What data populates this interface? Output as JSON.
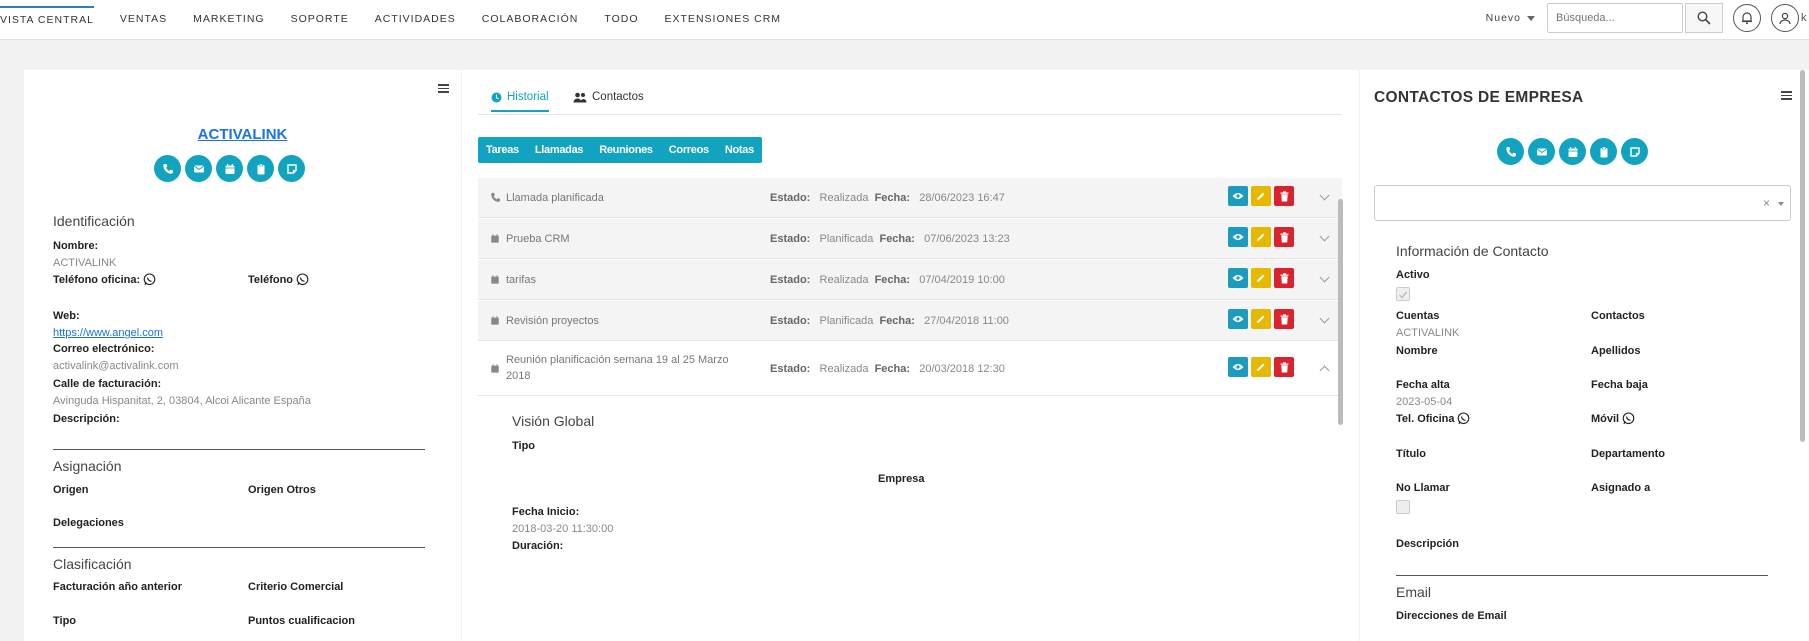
{
  "nav": {
    "items": [
      "VISTA CENTRAL",
      "VENTAS",
      "MARKETING",
      "SOPORTE",
      "ACTIVIDADES",
      "COLABORACIÓN",
      "TODO",
      "EXTENSIONES CRM"
    ],
    "nuevo": "Nuevo",
    "search_placeholder": "Búsqueda...",
    "user_initial": "k"
  },
  "left": {
    "company_name": "ACTIVALINK",
    "identificacion": {
      "title": "Identificación",
      "nombre_label": "Nombre:",
      "nombre_value": "ACTIVALINK",
      "tel_oficina_label": "Teléfono oficina:",
      "telefono_label": "Teléfono",
      "web_label": "Web:",
      "web_value": "https://www.angel.com",
      "email_label": "Correo electrónico:",
      "email_value": "activalink@activalink.com",
      "calle_label": "Calle de facturación:",
      "calle_value": "Avinguda Hispanitat, 2, 03804, Alcoi Alicante España",
      "descripcion_label": "Descripción:"
    },
    "asignacion": {
      "title": "Asignación",
      "origen": "Origen",
      "origen_otros": "Origen Otros",
      "delegaciones": "Delegaciones"
    },
    "clasificacion": {
      "title": "Clasificación",
      "facturacion": "Facturación año anterior",
      "criterio": "Criterio Comercial",
      "tipo": "Tipo",
      "puntos": "Puntos cualificacion"
    }
  },
  "middle": {
    "tabs": [
      "Historial",
      "Contactos"
    ],
    "filters": [
      "Tareas",
      "Llamadas",
      "Reuniones",
      "Correos",
      "Notas"
    ],
    "estado_label": "Estado:",
    "fecha_label": "Fecha:",
    "rows": [
      {
        "title": "Llamada planificada",
        "estado": "Realizada",
        "fecha": "28/06/2023 16:47",
        "icon": "phone-icon"
      },
      {
        "title": "Prueba CRM",
        "estado": "Planificada",
        "fecha": "07/06/2023 13:23",
        "icon": "calendar-icon"
      },
      {
        "title": "tarifas",
        "estado": "Realizada",
        "fecha": "07/04/2019 10:00",
        "icon": "calendar-icon"
      },
      {
        "title": "Revisión proyectos",
        "estado": "Planificada",
        "fecha": "27/04/2018 11:00",
        "icon": "calendar-icon"
      }
    ],
    "open_row": {
      "title_line1": "Reunión planificación semana 19 al 25 Marzo",
      "title_line2": "2018",
      "estado": "Realizada",
      "fecha": "20/03/2018 12:30"
    },
    "detail": {
      "title": "Visión Global",
      "tipo_label": "Tipo",
      "empresa_label": "Empresa",
      "fecha_inicio_label": "Fecha Inicio:",
      "fecha_inicio_value": "2018-03-20 11:30:00",
      "duracion_label": "Duración:"
    }
  },
  "right": {
    "title": "CONTACTOS DE EMPRESA",
    "select_clear": "×",
    "info_title": "Información de Contacto",
    "activo": "Activo",
    "cuentas": "Cuentas",
    "cuentas_value": "ACTIVALINK",
    "contactos": "Contactos",
    "nombre": "Nombre",
    "apellidos": "Apellidos",
    "fecha_alta": "Fecha alta",
    "fecha_alta_value": "2023-05-04",
    "fecha_baja": "Fecha baja",
    "tel_oficina": "Tel. Oficina",
    "movil": "Móvil",
    "titulo": "Título",
    "departamento": "Departamento",
    "no_llamar": "No Llamar",
    "asignado": "Asignado a",
    "descripcion": "Descripción",
    "email_title": "Email",
    "direcciones": "Direcciones de Email"
  },
  "colors": {
    "accent": "#12a3c0",
    "view": "#1a9bbf",
    "edit": "#e6b800",
    "delete": "#d9232e",
    "link": "#1a73e8"
  }
}
